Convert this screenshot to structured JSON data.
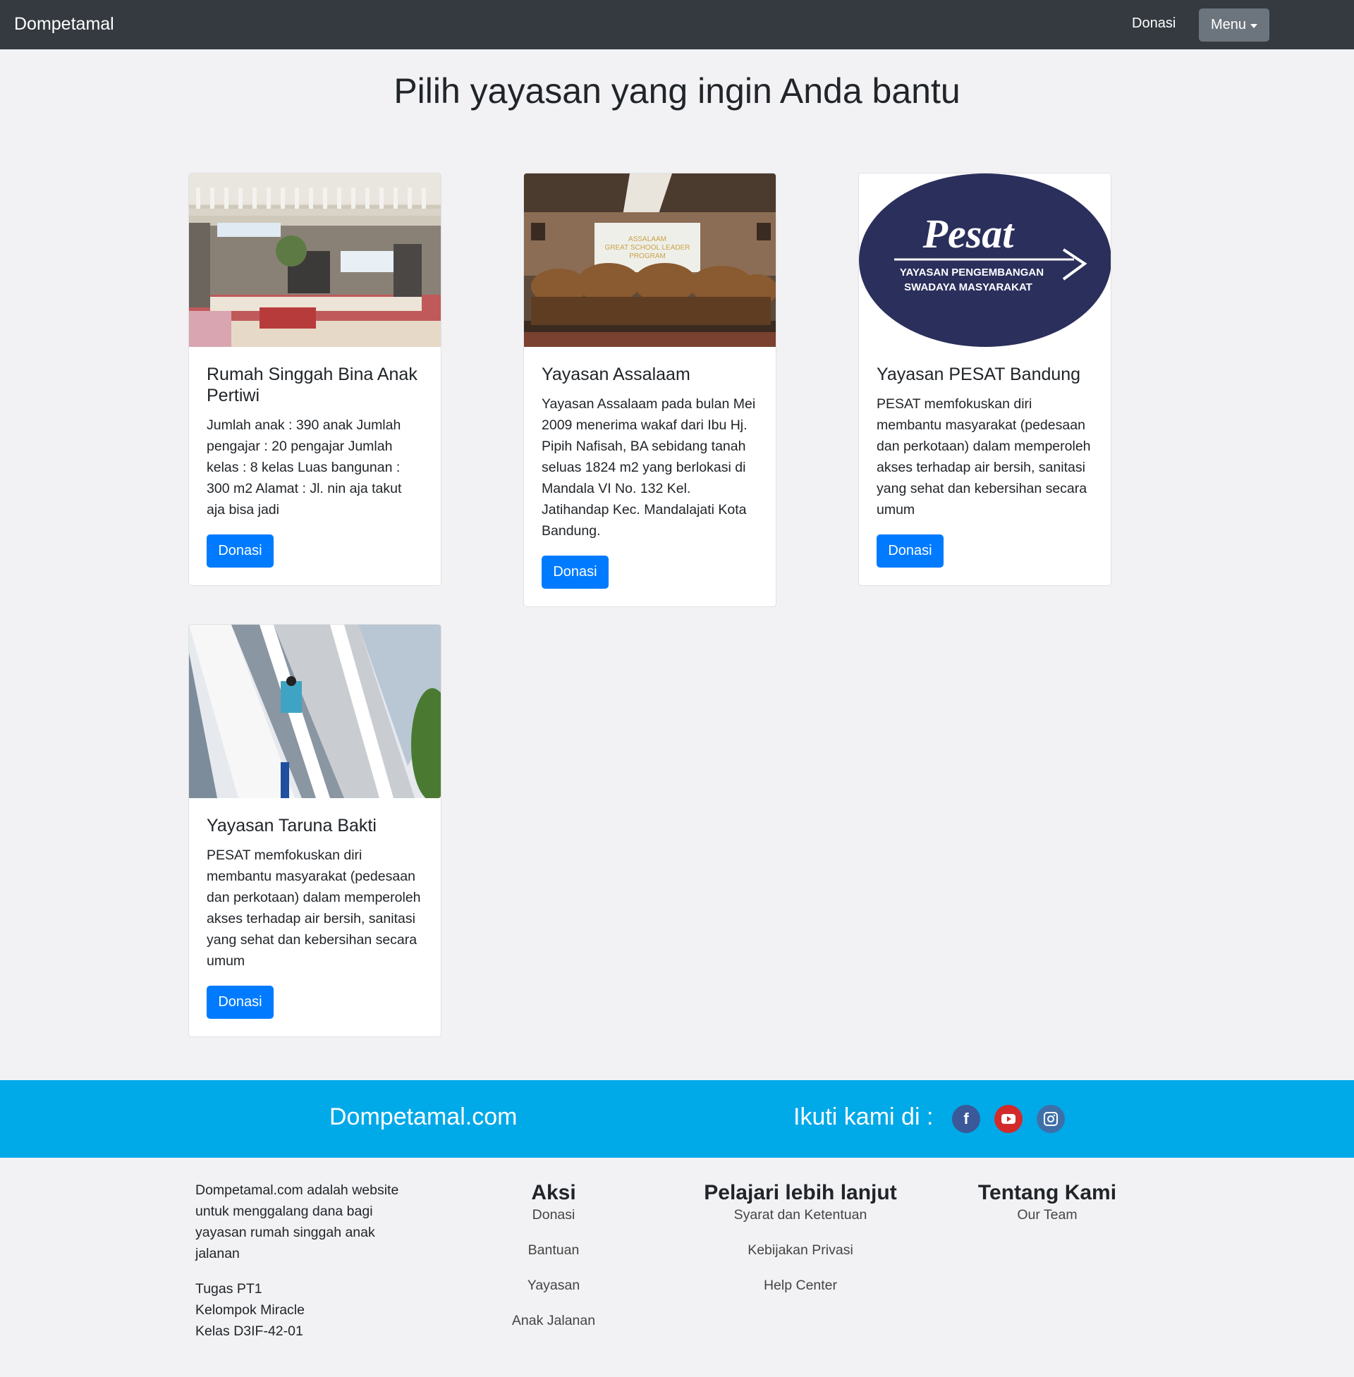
{
  "navbar": {
    "brand": "Dompetamal",
    "donasi": "Donasi",
    "menu": "Menu"
  },
  "heading": "Pilih yayasan yang ingin Anda bantu",
  "cards": [
    {
      "title": "Rumah Singgah Bina Anak Pertiwi",
      "text": "Jumlah anak : 390 anak Jumlah pengajar : 20 pengajar Jumlah kelas : 8 kelas Luas bangunan : 300 m2 Alamat : Jl. nin aja takut aja bisa jadi",
      "button": "Donasi",
      "image": "building-photo"
    },
    {
      "title": "Yayasan Assalaam",
      "text": "Yayasan Assalaam pada bulan Mei 2009 menerima wakaf dari Ibu Hj. Pipih Nafisah, BA sebidang tanah seluas 1824 m2 yang berlokasi di Mandala VI No. 132 Kel. Jatihandap Kec. Mandalajati Kota Bandung.",
      "button": "Donasi",
      "image": "group-photo",
      "banner_lines": [
        "ASSALAAM",
        "GREAT SCHOOL LEADER",
        "PROGRAM"
      ]
    },
    {
      "title": "Yayasan PESAT Bandung",
      "text": "PESAT memfokuskan diri membantu masyarakat (pedesaan dan perkotaan) dalam memperoleh akses terhadap air bersih, sanitasi yang sehat dan kebersihan secara umum",
      "button": "Donasi",
      "image": "pesat-logo",
      "logo": {
        "word": "Pesat",
        "line1": "YAYASAN PENGEMBANGAN",
        "line2": "SWADAYA MASYARAKAT"
      }
    },
    {
      "title": "Yayasan Taruna Bakti",
      "text": "PESAT memfokuskan diri membantu masyarakat (pedesaan dan perkotaan) dalam memperoleh akses terhadap air bersih, sanitasi yang sehat dan kebersihan secara umum",
      "button": "Donasi",
      "image": "school-building-photo"
    }
  ],
  "band": {
    "title": "Dompetamal.com",
    "follow": "Ikuti kami di :",
    "social": [
      "facebook-icon",
      "youtube-icon",
      "instagram-icon"
    ]
  },
  "footer": {
    "description": "Dompetamal.com adalah website untuk menggalang dana bagi yayasan rumah singgah anak jalanan",
    "team_lines": [
      "Tugas PT1",
      "Kelompok Miracle",
      "Kelas D3IF-42-01"
    ],
    "columns": [
      {
        "heading": "Aksi",
        "links": [
          "Donasi",
          "Bantuan",
          "Yayasan",
          "Anak Jalanan"
        ]
      },
      {
        "heading": "Pelajari lebih lanjut",
        "links": [
          "Syarat dan Ketentuan",
          "Kebijakan Privasi",
          "Help Center"
        ]
      },
      {
        "heading": "Tentang Kami",
        "links": [
          "Our Team"
        ]
      }
    ]
  },
  "colors": {
    "navbar": "#343a40",
    "primary": "#007bff",
    "band": "#00a9e8",
    "pesat_logo": "#2b2f5c"
  }
}
